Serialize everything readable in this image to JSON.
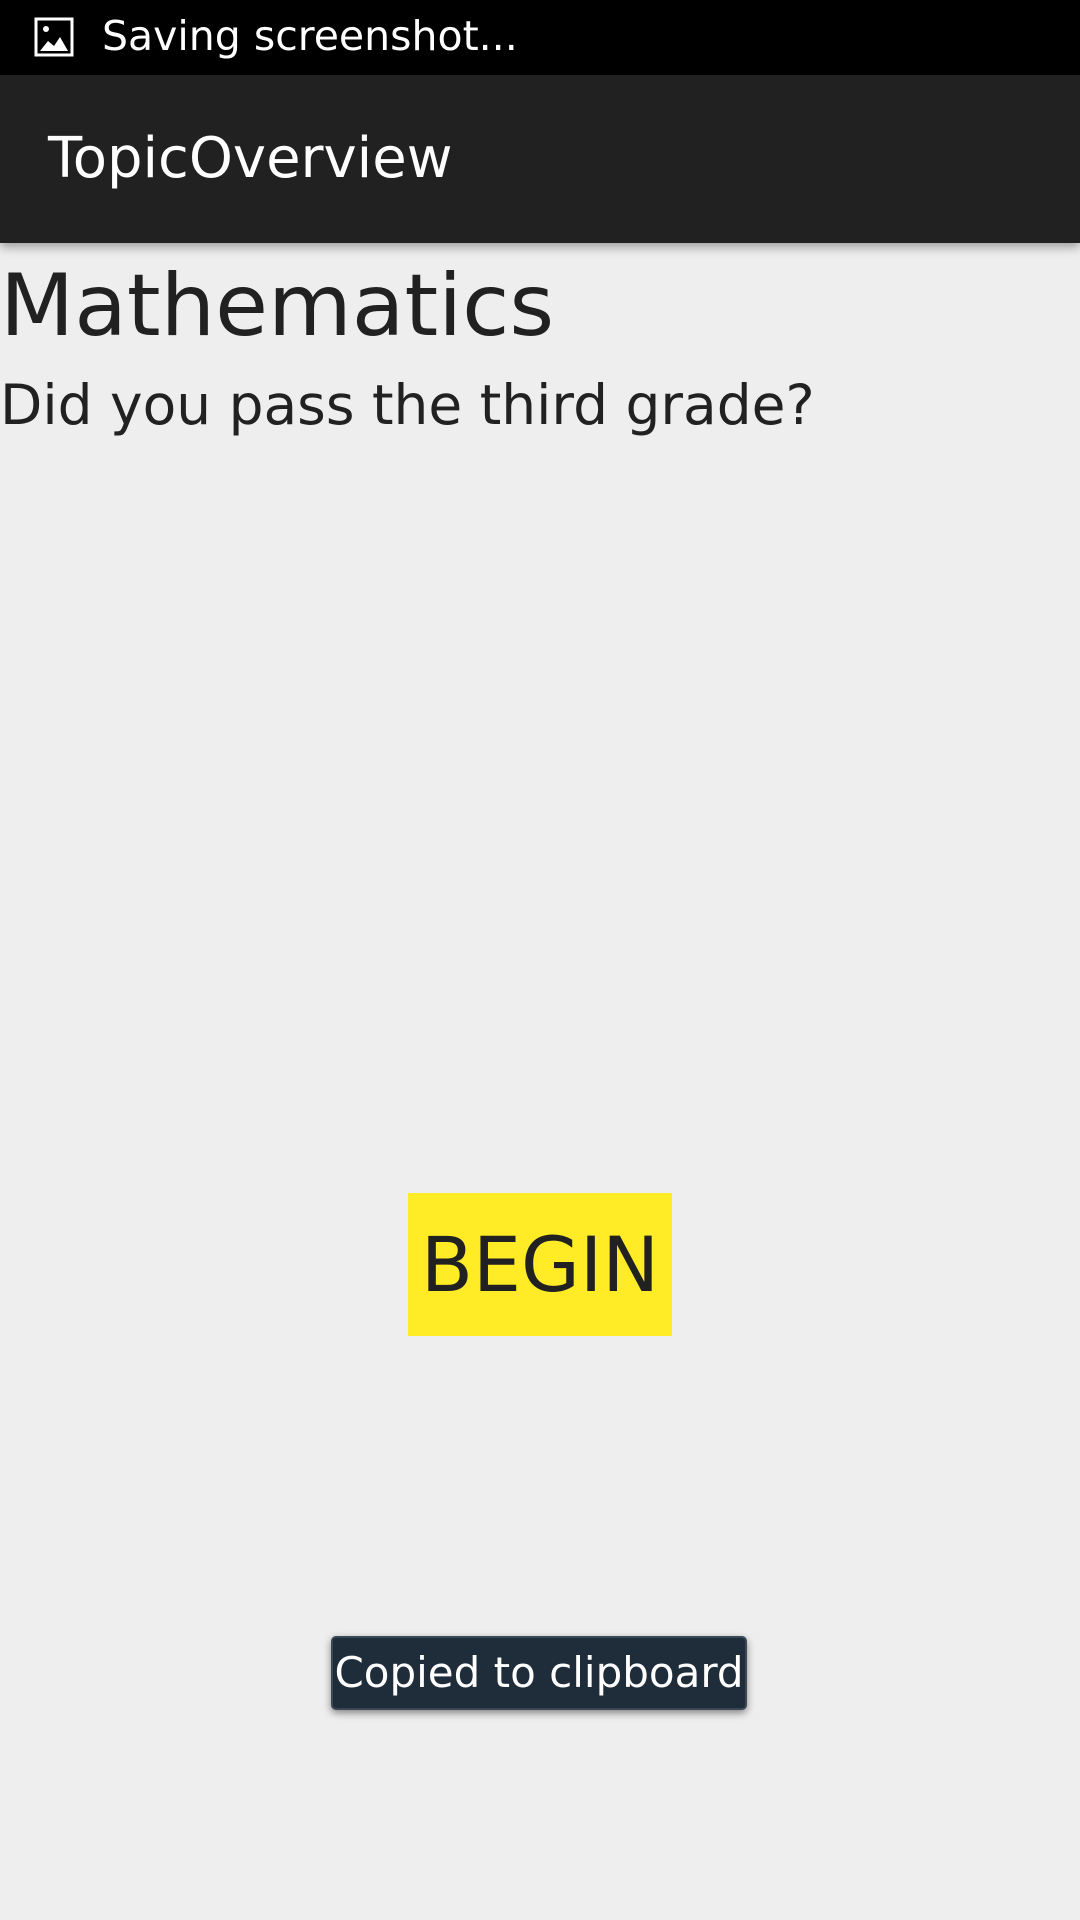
{
  "status_bar": {
    "icon": "image-icon",
    "text": "Saving screenshot..."
  },
  "action_bar": {
    "title": "TopicOverview"
  },
  "topic": {
    "title": "Mathematics",
    "description": "Did you pass the third grade?"
  },
  "begin_button": {
    "label": "BEGIN",
    "color": "#ffeb26"
  },
  "toast": {
    "text": "Copied to clipboard"
  },
  "colors": {
    "status_bar": "#000000",
    "action_bar": "#212121",
    "background": "#eeeeee",
    "text": "#212121",
    "toast": "#1f2d3b"
  }
}
